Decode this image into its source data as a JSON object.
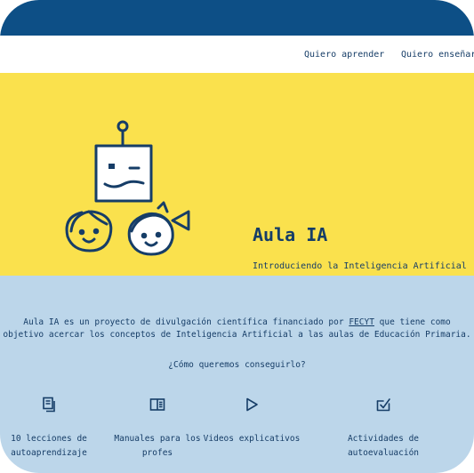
{
  "nav": {
    "links": [
      "Quiero aprender",
      "Quiero enseñar"
    ]
  },
  "hero": {
    "title": "Aula IA",
    "subtitle": "Introduciendo la Inteligencia Artificial en Educación Primaria",
    "logo_icon": "robot-and-children-logo"
  },
  "info": {
    "description_start": "Aula IA es un proyecto de divulgación científica financiado por",
    "description_link": "FECYT",
    "description_mid": "que tiene como",
    "description_line2": "objetivo acercar los conceptos de Inteligencia Artificial a las aulas de Educación Primaria.",
    "question": "¿Cómo queremos conseguirlo?"
  },
  "features": [
    {
      "icon": "documents-icon",
      "label": "10 lecciones de autoaprendizaje"
    },
    {
      "icon": "book-icon",
      "label": "Manuales para los profes"
    },
    {
      "icon": "play-icon",
      "label": "Videos explicativos"
    },
    {
      "icon": "checkbox-icon",
      "label": "Actividades de autoevaluación"
    }
  ],
  "colors": {
    "topbar": "#0d4f86",
    "hero_background": "#fae14d",
    "info_background": "#bcd6ea",
    "text": "#163d67"
  }
}
